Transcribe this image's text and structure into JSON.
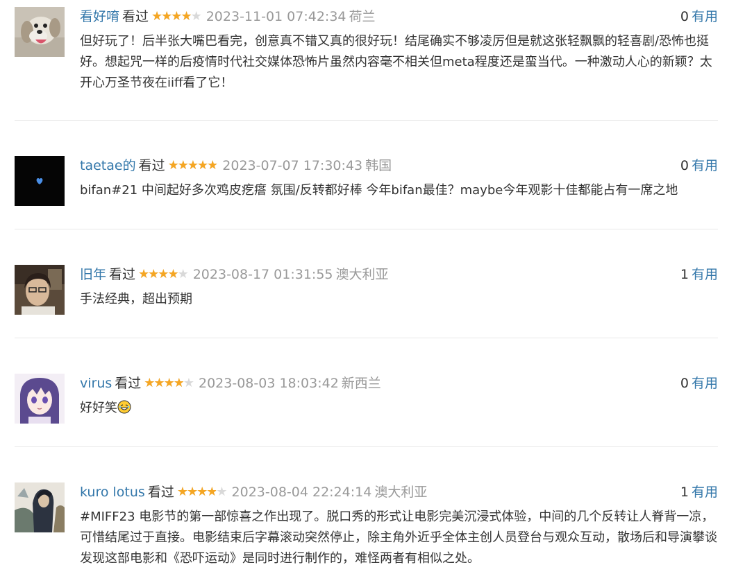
{
  "accent_link_color": "#3377aa",
  "star_color": "#f5a623",
  "useful_label": "有用",
  "comments": [
    {
      "user": "看好唷",
      "status": "看过",
      "rating": 4,
      "time": "2023-11-01 07:42:34",
      "location": "荷兰",
      "votes": "0",
      "text": "但好玩了！后半张大嘴巴看完，创意真不错又真的很好玩！结尾确实不够凌厉但是就这张轻飘飘的轻喜剧/恐怖也挺好。想起咒一样的后疫情时代社交媒体恐怖片虽然内容毫不相关但meta程度还是蛮当代。一种激动人心的新颖？太开心万圣节夜在iiff看了它！",
      "avatar_icon": "dog-avatar"
    },
    {
      "user": "taetae的",
      "status": "看过",
      "rating": 5,
      "time": "2023-07-07 17:30:43",
      "location": "韩国",
      "votes": "0",
      "text": "bifan#21 中间起好多次鸡皮疙瘩 氛围/反转都好棒 今年bifan最佳？maybe今年观影十佳都能占有一席之地",
      "avatar_icon": "heart-avatar"
    },
    {
      "user": "旧年",
      "status": "看过",
      "rating": 4,
      "time": "2023-08-17 01:31:55",
      "location": "澳大利亚",
      "votes": "1",
      "text": "手法经典，超出预期",
      "avatar_icon": "portrait-avatar"
    },
    {
      "user": "virus",
      "status": "看过",
      "rating": 4,
      "time": "2023-08-03 18:03:42",
      "location": "新西兰",
      "votes": "0",
      "text": "好好笑",
      "avatar_icon": "anime-avatar",
      "emoji_icon": "laughing-face-icon"
    },
    {
      "user": "kuro lotus",
      "status": "看过",
      "rating": 4,
      "time": "2023-08-04 22:24:14",
      "location": "澳大利亚",
      "votes": "1",
      "text": "#MIFF23 电影节的第一部惊喜之作出现了。脱口秀的形式让电影完美沉浸式体验，中间的几个反转让人脊背一凉，可惜结尾过于直接。电影结束后字幕滚动突然停止，除主角外近乎全体主创人员登台与观众互动，散场后和导演攀谈发现这部电影和《恐吓运动》是同时进行制作的，难怪两者有相似之处。",
      "avatar_icon": "illustration-avatar"
    }
  ]
}
